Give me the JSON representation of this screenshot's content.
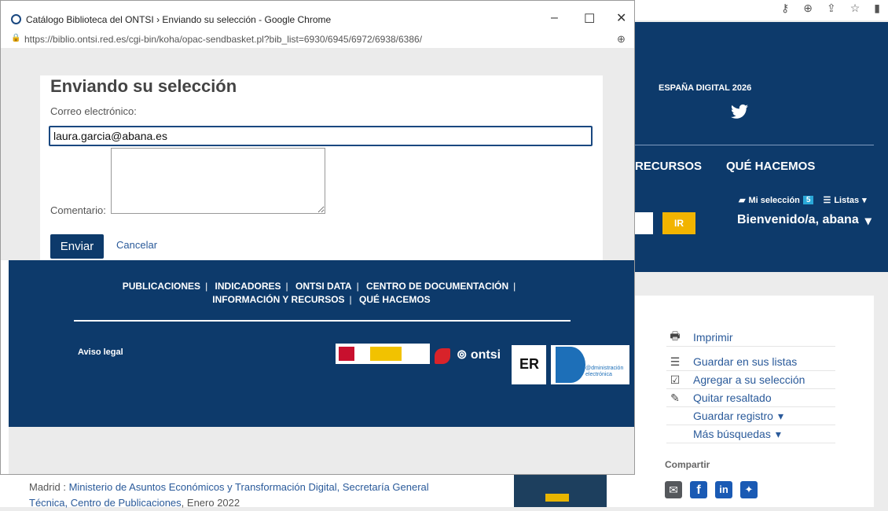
{
  "background_page": {
    "toolbar_icons": [
      "key-icon",
      "zoom-icon",
      "share-icon",
      "star-icon",
      "panel-icon"
    ],
    "espana_digital": "ESPAÑA DIGITAL 2026",
    "nav": {
      "recursos": "RECURSOS",
      "que_hacemos": "QUÉ HACEMOS"
    },
    "mi_seleccion": "Mi selección",
    "seleccion_count": "5",
    "listas": "Listas",
    "search_button": "IR",
    "welcome": "Bienvenido/a, abana",
    "actions": [
      {
        "label": "Imprimir",
        "icon": "printer-icon",
        "glyph": "🖶"
      },
      {
        "label": "Guardar en sus listas",
        "icon": "list-icon",
        "glyph": "☰"
      },
      {
        "label": "Agregar a su selección",
        "icon": "checkbox-icon",
        "glyph": "☑"
      },
      {
        "label": "Quitar resaltado",
        "icon": "pencil-icon",
        "glyph": "✎"
      },
      {
        "label": "Guardar registro",
        "icon": "",
        "glyph": ""
      },
      {
        "label": "Más búsquedas",
        "icon": "",
        "glyph": ""
      }
    ],
    "compartir": "Compartir",
    "share_icons": [
      "email-icon",
      "facebook-icon",
      "linkedin-icon",
      "twitter-icon"
    ],
    "record": {
      "publisher_prefix": "Madrid : ",
      "publisher": "Ministerio de Asuntos Económicos y Transformación Digital, Secretaría General Técnica, Centro de Publicaciones",
      "date": ", Enero 2022"
    }
  },
  "popup": {
    "window_title": "Catálogo Biblioteca del ONTSI › Enviando su selección - Google Chrome",
    "url": "https://biblio.ontsi.red.es/cgi-bin/koha/opac-sendbasket.pl?bib_list=6930/6945/6972/6938/6386/",
    "heading": "Enviando su selección",
    "email_label": "Correo electrónico:",
    "email_value": "laura.garcia@abana.es",
    "comment_label": "Comentario:",
    "comment_value": "",
    "send_button": "Enviar",
    "cancel_link": "Cancelar",
    "footer_links": [
      "PUBLICACIONES",
      "INDICADORES",
      "ONTSI DATA",
      "CENTRO DE DOCUMENTACIÓN",
      "INFORMACIÓN Y RECURSOS",
      "QUÉ HACEMOS"
    ],
    "aviso_legal": "Aviso legal",
    "logo_text": {
      "ontsi": "ontsi",
      "aenor": "ER",
      "administracion": "@dministración electrónica"
    }
  }
}
